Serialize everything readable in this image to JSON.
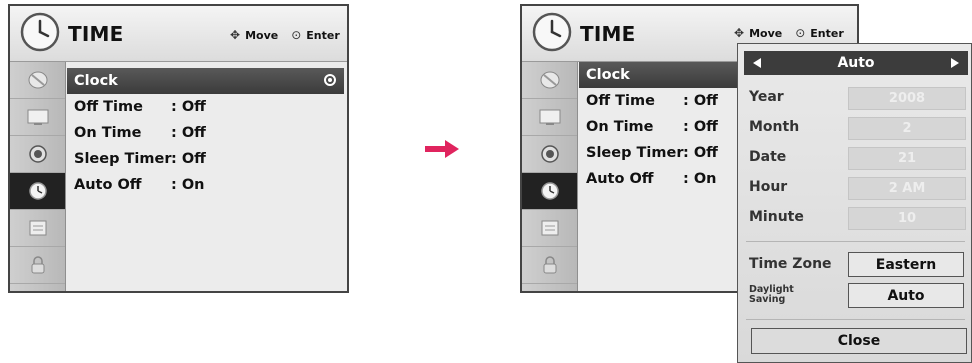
{
  "menu": {
    "title": "TIME",
    "hint_move": "Move",
    "hint_enter": "Enter",
    "items": [
      {
        "label": "Clock",
        "value": ""
      },
      {
        "label": "Off Time",
        "value": ": Off"
      },
      {
        "label": "On Time",
        "value": ": Off"
      },
      {
        "label": "Sleep Timer",
        "value": ": Off"
      },
      {
        "label": "Auto Off",
        "value": ": On"
      }
    ],
    "side_icons": [
      "satellite-icon",
      "monitor-icon",
      "speaker-icon",
      "clock-icon",
      "lock-list-icon",
      "padlock-icon"
    ],
    "active_side_index": 3
  },
  "clock_panel": {
    "mode": "Auto",
    "fields": [
      {
        "label": "Year",
        "value": "2008"
      },
      {
        "label": "Month",
        "value": "2"
      },
      {
        "label": "Date",
        "value": "21"
      },
      {
        "label": "Hour",
        "value": "2 AM"
      },
      {
        "label": "Minute",
        "value": "10"
      }
    ],
    "time_zone_label": "Time Zone",
    "time_zone_value": "Eastern",
    "daylight_label_1": "Daylight",
    "daylight_label_2": "Saving",
    "daylight_value": "Auto",
    "close_label": "Close"
  },
  "colors": {
    "arrow": "#e0245e",
    "highlight": "#4a4a4a"
  }
}
